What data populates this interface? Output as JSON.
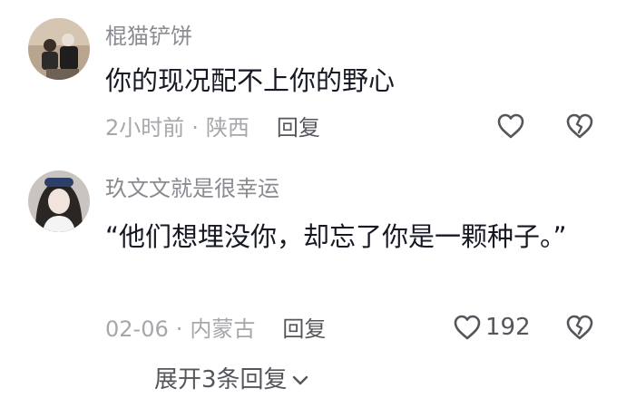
{
  "comments": [
    {
      "username": "棍猫铲饼",
      "text": "你的现况配不上你的野心",
      "time": "2小时前",
      "location": "陕西",
      "reply_label": "回复",
      "like_count": ""
    },
    {
      "username": "玖文文就是很幸运",
      "text": "“他们想埋没你，却忘了你是一颗种子。”",
      "time": "02-06",
      "location": "内蒙古",
      "reply_label": "回复",
      "like_count": "192"
    }
  ],
  "expand_replies": "展开3条回复",
  "colors": {
    "text": "#161823",
    "secondary": "#8a8b91",
    "meta": "#a6a7ab",
    "icon": "#55565c"
  }
}
